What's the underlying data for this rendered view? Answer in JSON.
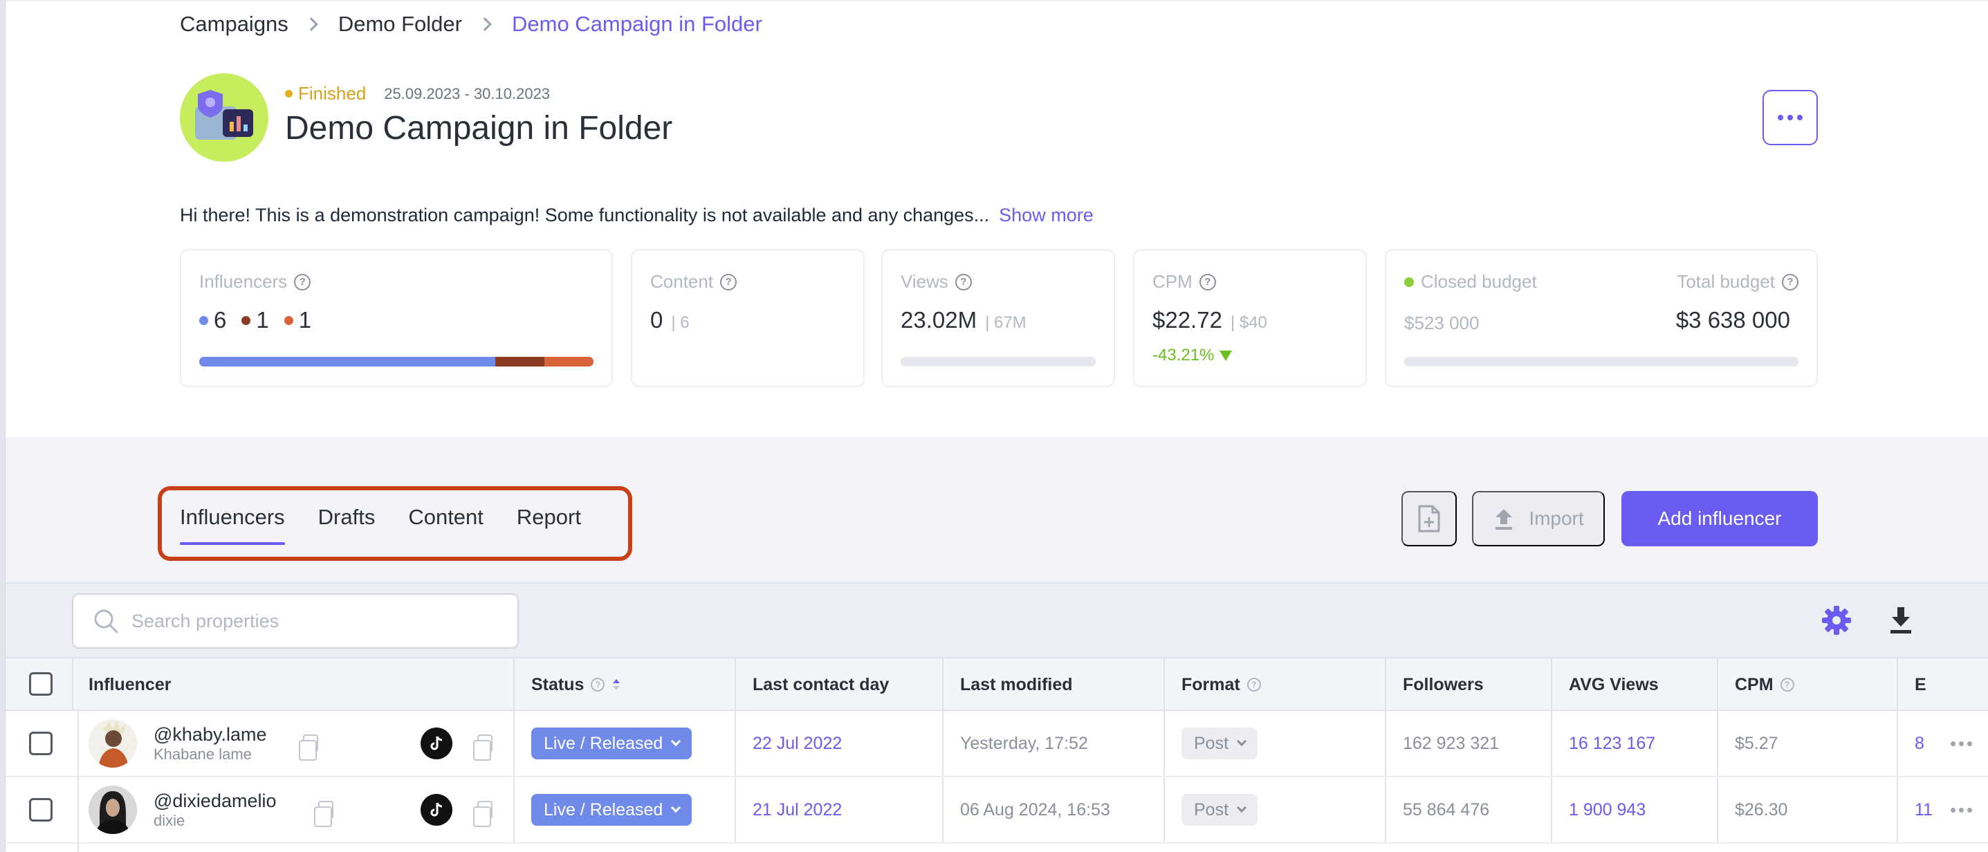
{
  "breadcrumb": [
    "Campaigns",
    "Demo Folder",
    "Demo Campaign in Folder"
  ],
  "campaign": {
    "status": "Finished",
    "dates": "25.09.2023 - 30.10.2023",
    "title": "Demo Campaign in Folder",
    "description": "Hi there! This is a demonstration campaign! Some functionality is not available and any changes...",
    "show_more": "Show more"
  },
  "stats": {
    "influencers": {
      "label": "Influencers",
      "counts": [
        "6",
        "1",
        "1"
      ],
      "count_colors": [
        "#6f8ae8",
        "#8a3b22",
        "#d9643a"
      ],
      "bar_fractions": [
        0.75,
        0.125,
        0.125
      ]
    },
    "content": {
      "label": "Content",
      "value": "0",
      "sub": "| 6"
    },
    "views": {
      "label": "Views",
      "value": "23.02M",
      "sub": "| 67M"
    },
    "cpm": {
      "label": "CPM",
      "value": "$22.72",
      "sub": "| $40",
      "delta": "-43.21%"
    },
    "budget": {
      "closed_label": "Closed budget",
      "closed_value": "$523 000",
      "total_label": "Total budget",
      "total_value": "$3 638 000"
    }
  },
  "tabs": [
    "Influencers",
    "Drafts",
    "Content",
    "Report"
  ],
  "actions": {
    "import": "Import",
    "add": "Add influencer"
  },
  "search": {
    "placeholder": "Search properties"
  },
  "table": {
    "headers": [
      "Influencer",
      "Status",
      "Last contact day",
      "Last modified",
      "Format",
      "Followers",
      "AVG Views",
      "CPM",
      "E"
    ],
    "rows": [
      {
        "handle": "@khaby.lame",
        "name": "Khabane lame",
        "status": "Live / Released",
        "last_contact": "22 Jul 2022",
        "last_modified": "Yesterday, 17:52",
        "format": "Post",
        "followers": "162 923 321",
        "avg_views": "16 123 167",
        "cpm": "$5.27",
        "extra": "8"
      },
      {
        "handle": "@dixiedamelio",
        "name": "dixie",
        "status": "Live / Released",
        "last_contact": "21 Jul 2022",
        "last_modified": "06 Aug 2024, 16:53",
        "format": "Post",
        "followers": "55 864 476",
        "avg_views": "1 900 943",
        "cpm": "$26.30",
        "extra": "11"
      }
    ]
  },
  "colors": {
    "accent": "#6a5cf0",
    "status_finished": "#d4a21c",
    "status_pill": "#6f8ae8",
    "positive": "#6bbf1e",
    "highlight_border": "#c7401a"
  }
}
